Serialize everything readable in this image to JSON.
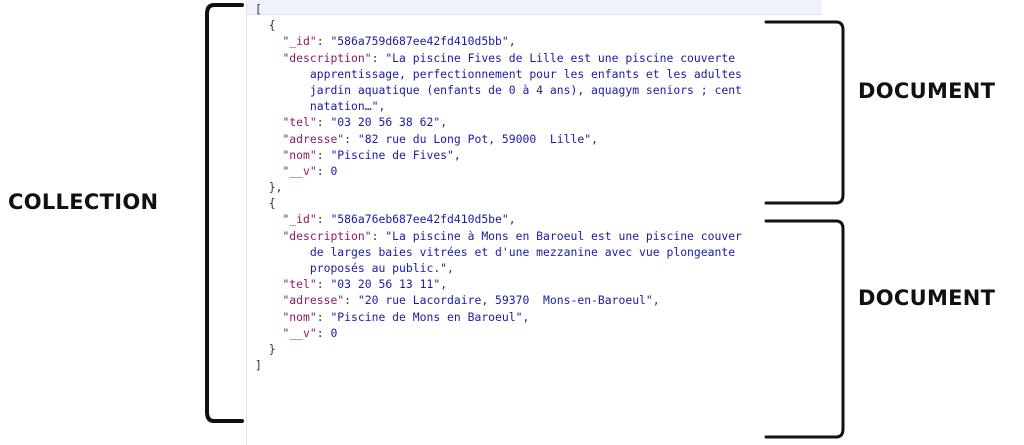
{
  "labels": {
    "collection": "COLLECTION",
    "document_1": "DOCUMENT",
    "document_2": "DOCUMENT"
  },
  "json_lines": [
    {
      "indent": "",
      "parts": [
        {
          "t": "[",
          "c": "p"
        }
      ]
    },
    {
      "indent": "  ",
      "parts": [
        {
          "t": "{",
          "c": "p"
        }
      ]
    },
    {
      "indent": "    ",
      "parts": [
        {
          "t": "\"_id\"",
          "c": "k"
        },
        {
          "t": ": ",
          "c": "p"
        },
        {
          "t": "\"586a759d687ee42fd410d5bb\"",
          "c": "s"
        },
        {
          "t": ",",
          "c": "p"
        }
      ]
    },
    {
      "indent": "    ",
      "parts": [
        {
          "t": "\"description\"",
          "c": "k"
        },
        {
          "t": ": ",
          "c": "p"
        },
        {
          "t": "\"La piscine Fives de Lille est une piscine couverte",
          "c": "s"
        }
      ]
    },
    {
      "indent": "        ",
      "parts": [
        {
          "t": "apprentissage, perfectionnement pour les enfants et les adultes",
          "c": "s"
        }
      ]
    },
    {
      "indent": "        ",
      "parts": [
        {
          "t": "jardin aquatique (enfants de 0 à 4 ans), aquagym seniors ; cent",
          "c": "s"
        }
      ]
    },
    {
      "indent": "        ",
      "parts": [
        {
          "t": "natation…\"",
          "c": "s"
        },
        {
          "t": ",",
          "c": "p"
        }
      ]
    },
    {
      "indent": "    ",
      "parts": [
        {
          "t": "\"tel\"",
          "c": "k"
        },
        {
          "t": ": ",
          "c": "p"
        },
        {
          "t": "\"03 20 56 38 62\"",
          "c": "s"
        },
        {
          "t": ",",
          "c": "p"
        }
      ]
    },
    {
      "indent": "    ",
      "parts": [
        {
          "t": "\"adresse\"",
          "c": "k"
        },
        {
          "t": ": ",
          "c": "p"
        },
        {
          "t": "\"82 rue du Long Pot, 59000  Lille\"",
          "c": "s"
        },
        {
          "t": ",",
          "c": "p"
        }
      ]
    },
    {
      "indent": "    ",
      "parts": [
        {
          "t": "\"nom\"",
          "c": "k"
        },
        {
          "t": ": ",
          "c": "p"
        },
        {
          "t": "\"Piscine de Fives\"",
          "c": "s"
        },
        {
          "t": ",",
          "c": "p"
        }
      ]
    },
    {
      "indent": "    ",
      "parts": [
        {
          "t": "\"__v\"",
          "c": "k"
        },
        {
          "t": ": ",
          "c": "p"
        },
        {
          "t": "0",
          "c": "n"
        }
      ]
    },
    {
      "indent": "  ",
      "parts": [
        {
          "t": "},",
          "c": "p"
        }
      ]
    },
    {
      "indent": "  ",
      "parts": [
        {
          "t": "{",
          "c": "p"
        }
      ]
    },
    {
      "indent": "    ",
      "parts": [
        {
          "t": "\"_id\"",
          "c": "k"
        },
        {
          "t": ": ",
          "c": "p"
        },
        {
          "t": "\"586a76eb687ee42fd410d5be\"",
          "c": "s"
        },
        {
          "t": ",",
          "c": "p"
        }
      ]
    },
    {
      "indent": "    ",
      "parts": [
        {
          "t": "\"description\"",
          "c": "k"
        },
        {
          "t": ": ",
          "c": "p"
        },
        {
          "t": "\"La piscine à Mons en Baroeul est une piscine couver",
          "c": "s"
        }
      ]
    },
    {
      "indent": "        ",
      "parts": [
        {
          "t": "de larges baies vitrées et d'une mezzanine avec vue plongeante",
          "c": "s"
        }
      ]
    },
    {
      "indent": "        ",
      "parts": [
        {
          "t": "proposés au public.\"",
          "c": "s"
        },
        {
          "t": ",",
          "c": "p"
        }
      ]
    },
    {
      "indent": "    ",
      "parts": [
        {
          "t": "\"tel\"",
          "c": "k"
        },
        {
          "t": ": ",
          "c": "p"
        },
        {
          "t": "\"03 20 56 13 11\"",
          "c": "s"
        },
        {
          "t": ",",
          "c": "p"
        }
      ]
    },
    {
      "indent": "    ",
      "parts": [
        {
          "t": "\"adresse\"",
          "c": "k"
        },
        {
          "t": ": ",
          "c": "p"
        },
        {
          "t": "\"20 rue Lacordaire, 59370  Mons-en-Baroeul\"",
          "c": "s"
        },
        {
          "t": ",",
          "c": "p"
        }
      ]
    },
    {
      "indent": "    ",
      "parts": [
        {
          "t": "\"nom\"",
          "c": "k"
        },
        {
          "t": ": ",
          "c": "p"
        },
        {
          "t": "\"Piscine de Mons en Baroeul\"",
          "c": "s"
        },
        {
          "t": ",",
          "c": "p"
        }
      ]
    },
    {
      "indent": "    ",
      "parts": [
        {
          "t": "\"__v\"",
          "c": "k"
        },
        {
          "t": ": ",
          "c": "p"
        },
        {
          "t": "0",
          "c": "n"
        }
      ]
    },
    {
      "indent": "  ",
      "parts": [
        {
          "t": "}",
          "c": "p"
        }
      ]
    },
    {
      "indent": "",
      "parts": [
        {
          "t": "]",
          "c": "p"
        }
      ]
    }
  ],
  "colors": {
    "key": "#8a1b68",
    "string": "#1a1aa6",
    "punct": "#333333",
    "brace": "#111111"
  }
}
